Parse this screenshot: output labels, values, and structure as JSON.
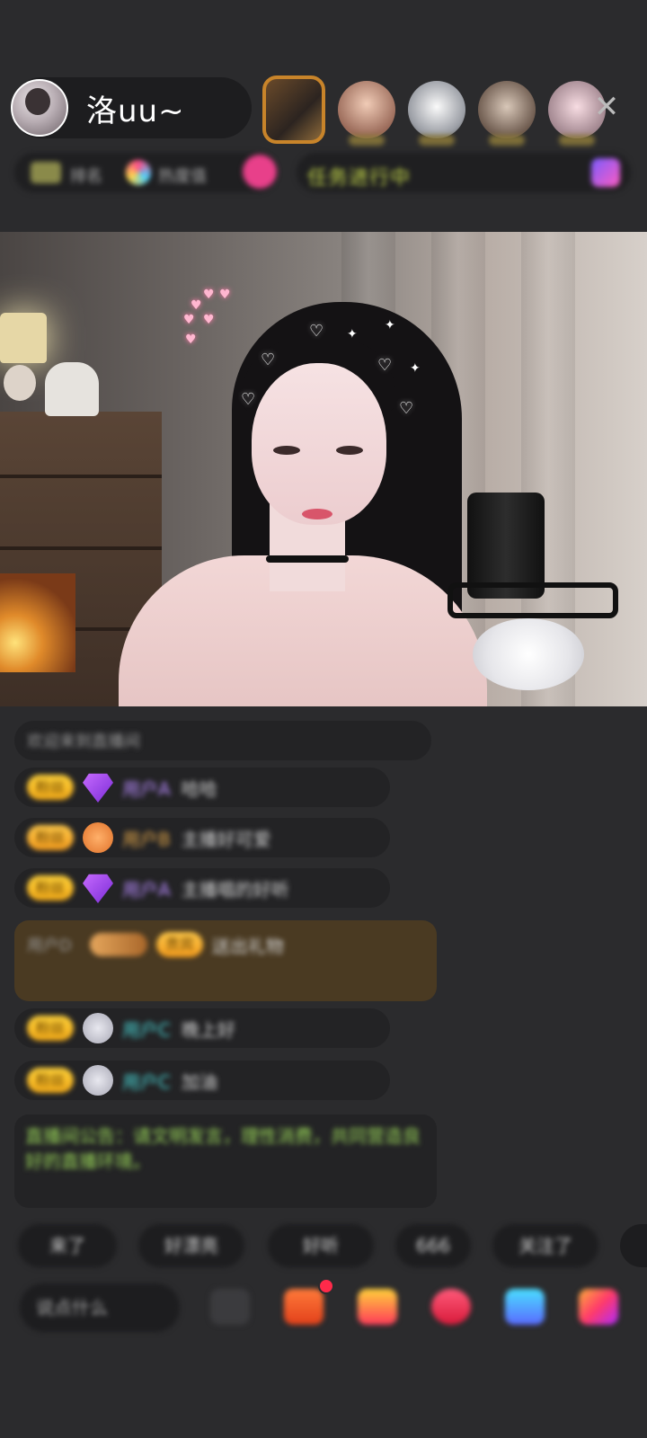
{
  "host": {
    "name": "洛uu~"
  },
  "top_info": {
    "rank_text": "排名",
    "popularity_text": "热度值",
    "task_text": "任务进行中"
  },
  "close_icon": "✕",
  "chat": {
    "system_msg": "欢迎来到直播间",
    "lines": [
      {
        "badge": "粉丝",
        "name": "用户A",
        "msg": "哈哈"
      },
      {
        "badge": "粉丝",
        "name": "用户B",
        "msg": "主播好可爱"
      },
      {
        "badge": "粉丝",
        "name": "用户A",
        "msg": "主播唱的好听"
      },
      {
        "badge": "粉丝",
        "name": "用户C",
        "msg": "晚上好"
      },
      {
        "badge": "粉丝",
        "name": "用户C",
        "msg": "加油"
      }
    ],
    "vip": {
      "badge": "贵宾",
      "name": "用户D",
      "msg": "送出礼物"
    },
    "notice": "直播间公告：请文明发言，理性消费，共同营造良好的直播环境。"
  },
  "quick_replies": [
    "来了",
    "好漂亮",
    "好听",
    "666",
    "关注了"
  ],
  "input": {
    "placeholder": "说点什么"
  },
  "colors": {
    "background": "#2b2b2d",
    "accent_gold": "#ffd23a",
    "notice_green": "#9bd85a"
  }
}
